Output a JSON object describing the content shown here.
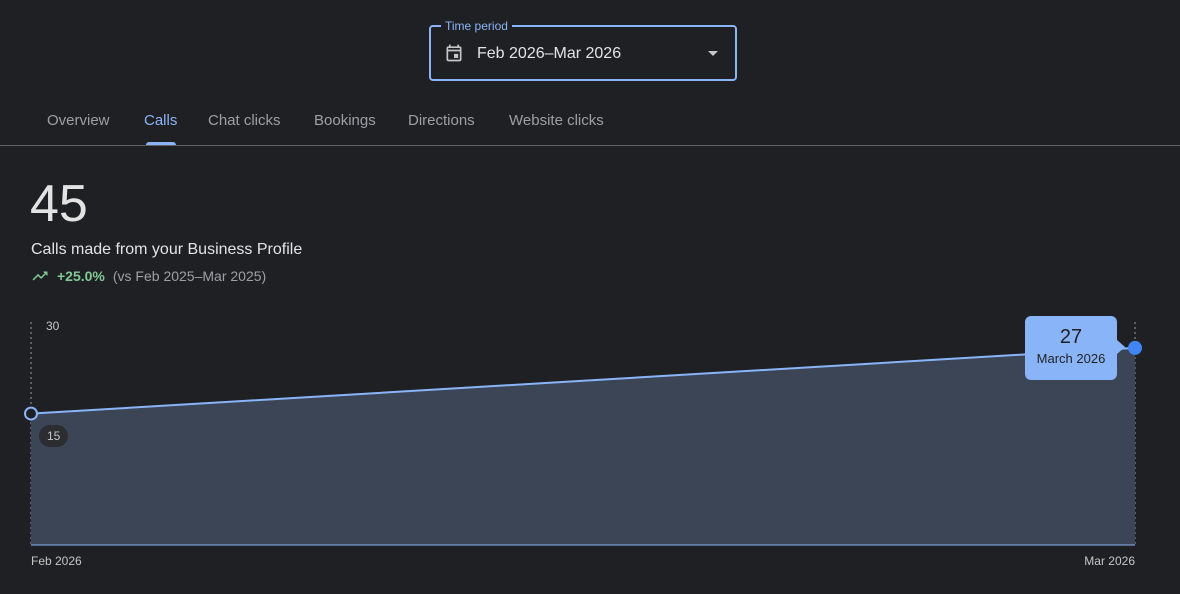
{
  "time_period": {
    "label": "Time period",
    "value": "Feb 2026–Mar 2026"
  },
  "tabs": [
    {
      "label": "Overview",
      "active": false
    },
    {
      "label": "Calls",
      "active": true
    },
    {
      "label": "Chat clicks",
      "active": false
    },
    {
      "label": "Bookings",
      "active": false
    },
    {
      "label": "Directions",
      "active": false
    },
    {
      "label": "Website clicks",
      "active": false
    }
  ],
  "metric": {
    "value": "45",
    "description": "Calls made from your Business Profile",
    "change": "+25.0%",
    "comparison": "(vs Feb 2025–Mar 2025)"
  },
  "colors": {
    "accent": "#8ab4f8",
    "positive": "#81c995",
    "area_fill": "#3c4556",
    "point": "#4285f4",
    "background": "#1f2023"
  },
  "chart_data": {
    "type": "area",
    "x": [
      "Feb 2026",
      "Mar 2026"
    ],
    "series": [
      {
        "values": [
          18,
          27
        ]
      }
    ],
    "y_ticks": [
      "30",
      "15"
    ],
    "x_tick_labels": [
      "Feb 2026",
      "Mar 2026"
    ],
    "ylim": [
      0,
      30
    ],
    "grid": false,
    "tooltip": {
      "value": "27",
      "label": "March 2026"
    }
  }
}
